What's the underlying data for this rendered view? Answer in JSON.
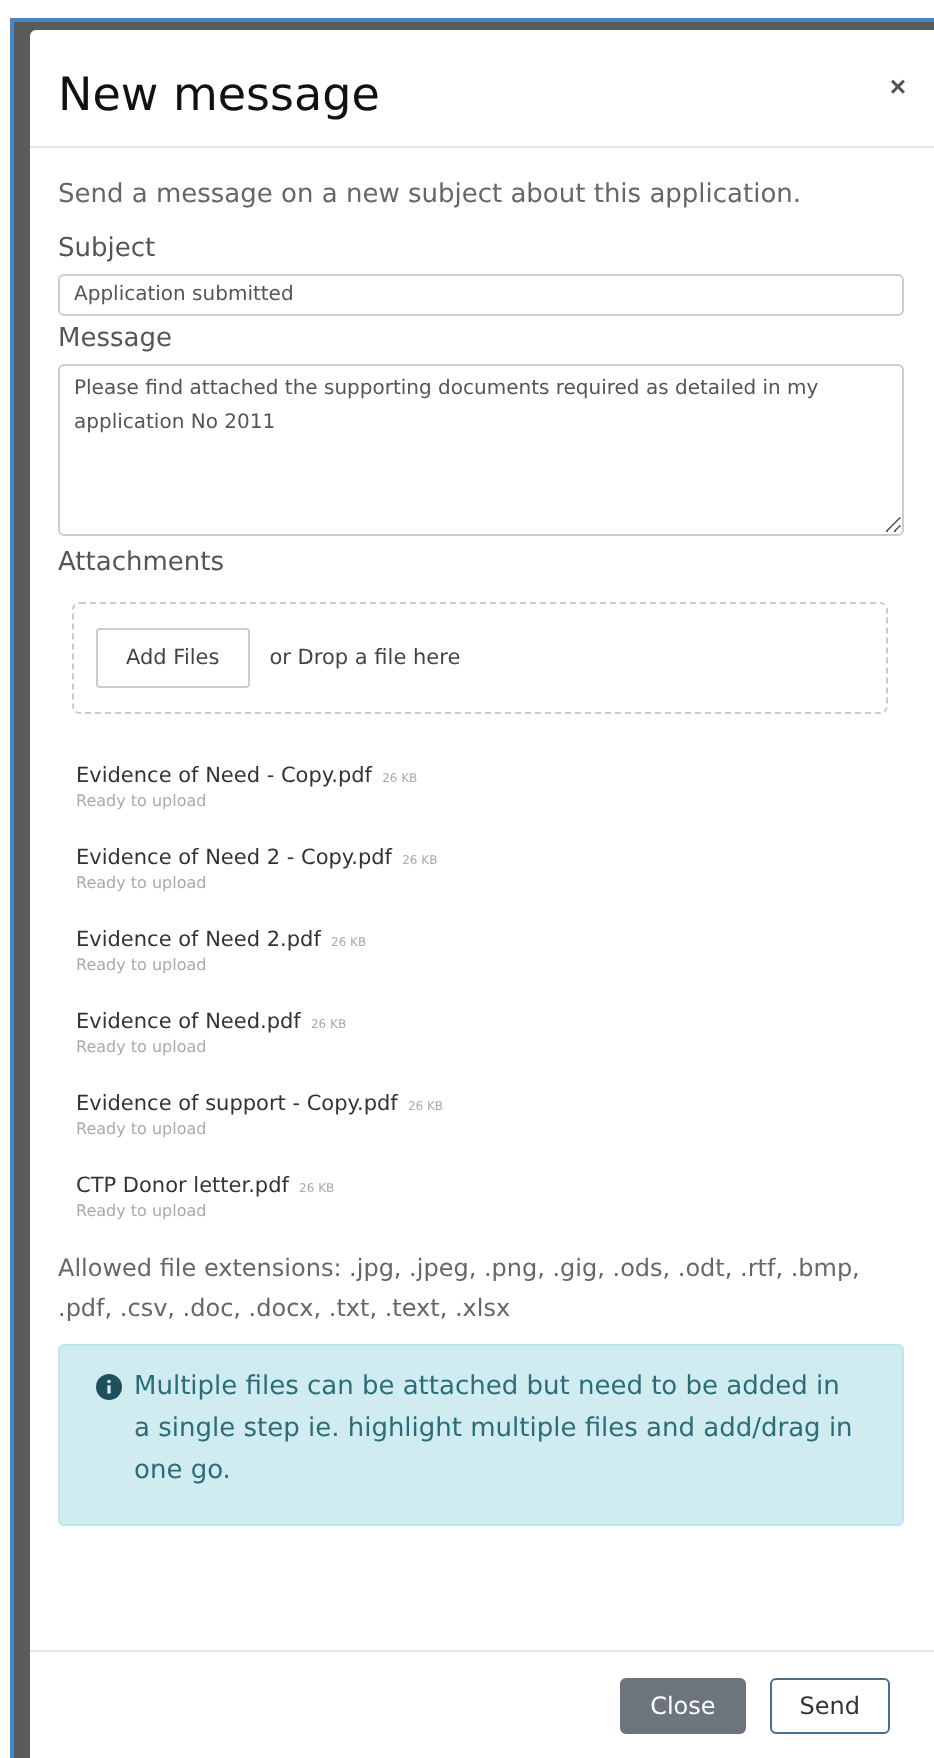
{
  "dialog": {
    "title": "New message",
    "close": "×",
    "intro": "Send a message on a new subject about this application.",
    "subject": {
      "label": "Subject",
      "value": "Application submitted"
    },
    "message": {
      "label": "Message",
      "value": "Please find attached the supporting documents required as detailed in my application No 2011"
    },
    "attachments": {
      "label": "Attachments",
      "button": "Add Files",
      "drop_hint": "or Drop a file here",
      "files": [
        {
          "name": "Evidence of Need - Copy.pdf",
          "size": "26 KB",
          "status": "Ready to upload"
        },
        {
          "name": "Evidence of Need 2 - Copy.pdf",
          "size": "26 KB",
          "status": "Ready to upload"
        },
        {
          "name": "Evidence of Need 2.pdf",
          "size": "26 KB",
          "status": "Ready to upload"
        },
        {
          "name": "Evidence of Need.pdf",
          "size": "26 KB",
          "status": "Ready to upload"
        },
        {
          "name": "Evidence of support - Copy.pdf",
          "size": "26 KB",
          "status": "Ready to upload"
        },
        {
          "name": "CTP Donor letter.pdf",
          "size": "26 KB",
          "status": "Ready to upload"
        }
      ],
      "allowed": "Allowed file extensions: .jpg, .jpeg, .png, .gig, .ods, .odt, .rtf, .bmp, .pdf, .csv, .doc, .docx, .txt, .text, .xlsx",
      "info": "Multiple files can be attached but need to be added in a single step ie. highlight multiple files and add/drag in one go."
    },
    "buttons": [
      {
        "label": "Close",
        "kind": "secondary"
      },
      {
        "label": "Send",
        "kind": "primary"
      }
    ]
  }
}
